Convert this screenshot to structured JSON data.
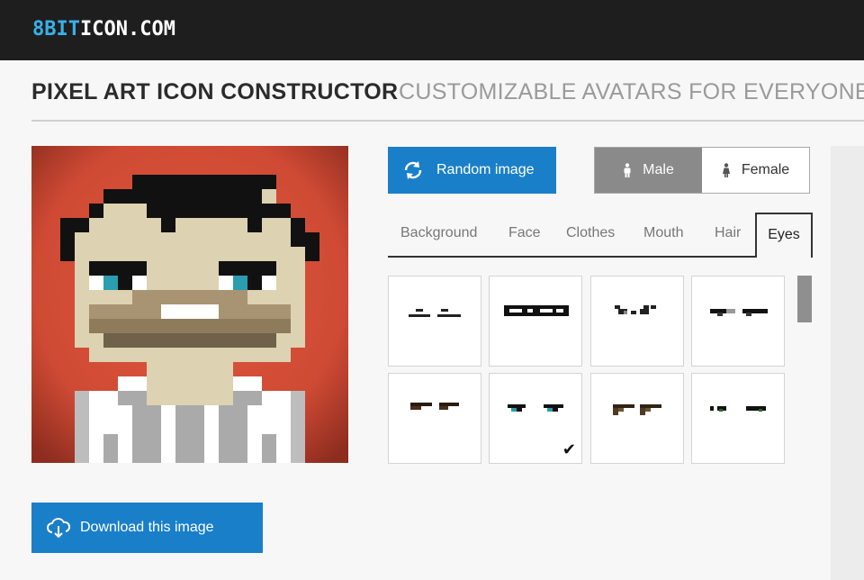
{
  "app": {
    "logo_accent": "8BIT",
    "logo_main": "ICON.COM"
  },
  "header": {
    "title": "PIXEL ART ICON CONSTRUCTOR",
    "subtitle": "CUSTOMIZABLE AVATARS FOR EVERYONE."
  },
  "controls": {
    "random_label": "Random image",
    "random_icon": "refresh-icon",
    "gender": {
      "male_label": "Male",
      "female_label": "Female",
      "selected": "Male"
    }
  },
  "tabs": {
    "items": [
      "Background",
      "Face",
      "Clothes",
      "Mouth",
      "Hair",
      "Eyes"
    ],
    "active": "Eyes"
  },
  "eyes_options": {
    "count_visible": 8,
    "selected_index": 5
  },
  "download": {
    "label": "Download this image",
    "icon": "cloud-download-icon"
  },
  "colors": {
    "accent_blue": "#1a7fc9",
    "topbar": "#1e1e1e",
    "logo_blue": "#39b0ea",
    "gender_active": "#8a8a8a"
  }
}
